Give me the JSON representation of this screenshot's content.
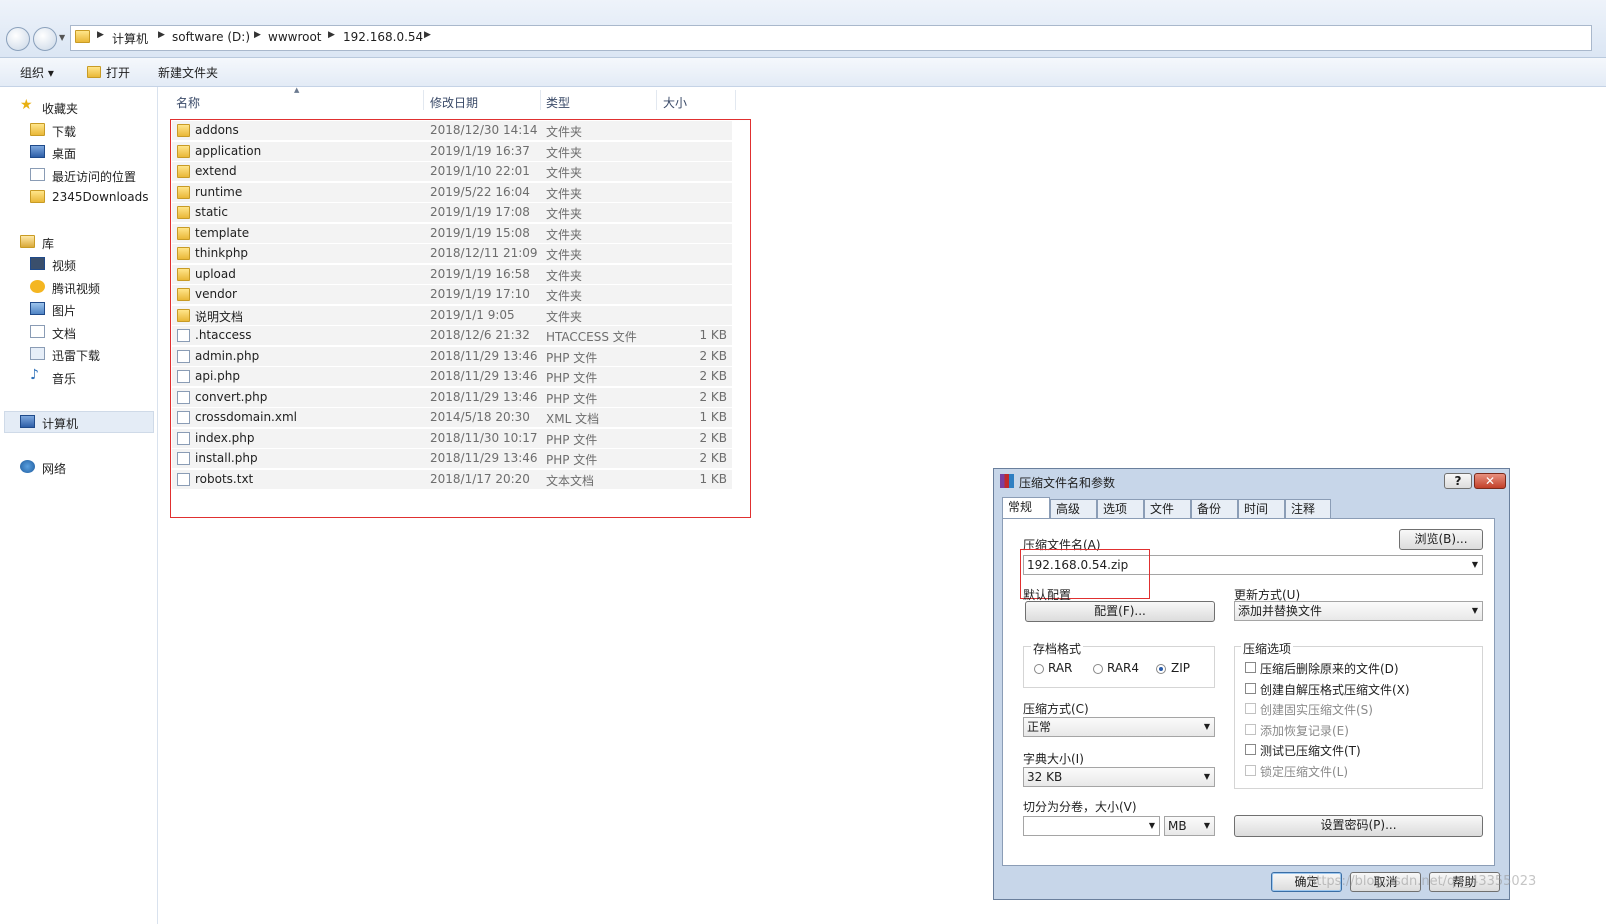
{
  "address_bar": {
    "crumbs": [
      "计算机",
      "software (D:)",
      "wwwroot",
      "192.168.0.54"
    ]
  },
  "toolbar": {
    "organize": "组织 ▾",
    "open": "打开",
    "new_folder": "新建文件夹"
  },
  "sidebar": {
    "favorites": "收藏夹",
    "favorite_items": [
      "下载",
      "桌面",
      "最近访问的位置",
      "2345Downloads"
    ],
    "libraries": "库",
    "library_items": [
      "视频",
      "腾讯视频",
      "图片",
      "文档",
      "迅雷下载",
      "音乐"
    ],
    "computer": "计算机",
    "network": "网络"
  },
  "columns": {
    "name": "名称",
    "date": "修改日期",
    "type": "类型",
    "size": "大小"
  },
  "files": [
    {
      "name": "addons",
      "date": "2018/12/30 14:14",
      "type": "文件夹",
      "size": "",
      "kind": "folder"
    },
    {
      "name": "application",
      "date": "2019/1/19 16:37",
      "type": "文件夹",
      "size": "",
      "kind": "folder"
    },
    {
      "name": "extend",
      "date": "2019/1/10 22:01",
      "type": "文件夹",
      "size": "",
      "kind": "folder"
    },
    {
      "name": "runtime",
      "date": "2019/5/22 16:04",
      "type": "文件夹",
      "size": "",
      "kind": "folder"
    },
    {
      "name": "static",
      "date": "2019/1/19 17:08",
      "type": "文件夹",
      "size": "",
      "kind": "folder"
    },
    {
      "name": "template",
      "date": "2019/1/19 15:08",
      "type": "文件夹",
      "size": "",
      "kind": "folder"
    },
    {
      "name": "thinkphp",
      "date": "2018/12/11 21:09",
      "type": "文件夹",
      "size": "",
      "kind": "folder"
    },
    {
      "name": "upload",
      "date": "2019/1/19 16:58",
      "type": "文件夹",
      "size": "",
      "kind": "folder"
    },
    {
      "name": "vendor",
      "date": "2019/1/19 17:10",
      "type": "文件夹",
      "size": "",
      "kind": "folder"
    },
    {
      "name": "说明文档",
      "date": "2019/1/1 9:05",
      "type": "文件夹",
      "size": "",
      "kind": "folder"
    },
    {
      "name": ".htaccess",
      "date": "2018/12/6 21:32",
      "type": "HTACCESS 文件",
      "size": "1 KB",
      "kind": "file"
    },
    {
      "name": "admin.php",
      "date": "2018/11/29 13:46",
      "type": "PHP 文件",
      "size": "2 KB",
      "kind": "file"
    },
    {
      "name": "api.php",
      "date": "2018/11/29 13:46",
      "type": "PHP 文件",
      "size": "2 KB",
      "kind": "file"
    },
    {
      "name": "convert.php",
      "date": "2018/11/29 13:46",
      "type": "PHP 文件",
      "size": "2 KB",
      "kind": "file"
    },
    {
      "name": "crossdomain.xml",
      "date": "2014/5/18 20:30",
      "type": "XML 文档",
      "size": "1 KB",
      "kind": "file"
    },
    {
      "name": "index.php",
      "date": "2018/11/30 10:17",
      "type": "PHP 文件",
      "size": "2 KB",
      "kind": "file"
    },
    {
      "name": "install.php",
      "date": "2018/11/29 13:46",
      "type": "PHP 文件",
      "size": "2 KB",
      "kind": "file"
    },
    {
      "name": "robots.txt",
      "date": "2018/1/17 20:20",
      "type": "文本文档",
      "size": "1 KB",
      "kind": "file"
    }
  ],
  "dialog": {
    "title": "压缩文件名和参数",
    "help": "?",
    "close": "✕",
    "tabs": [
      "常规",
      "高级",
      "选项",
      "文件",
      "备份",
      "时间",
      "注释"
    ],
    "archive_name_label": "压缩文件名(A)",
    "browse": "浏览(B)...",
    "archive_name": "192.168.0.54.zip",
    "default_profile_label": "默认配置",
    "profiles_button": "配置(F)...",
    "update_mode_label": "更新方式(U)",
    "update_mode": "添加并替换文件",
    "format_label": "存档格式",
    "formats": [
      "RAR",
      "RAR4",
      "ZIP"
    ],
    "selected_format": "ZIP",
    "method_label": "压缩方式(C)",
    "method": "正常",
    "dict_label": "字典大小(I)",
    "dict": "32 KB",
    "split_label": "切分为分卷，大小(V)",
    "split_value": "",
    "split_unit": "MB",
    "options_label": "压缩选项",
    "options": [
      {
        "label": "压缩后删除原来的文件(D)",
        "enabled": true
      },
      {
        "label": "创建自解压格式压缩文件(X)",
        "enabled": true
      },
      {
        "label": "创建固实压缩文件(S)",
        "enabled": false
      },
      {
        "label": "添加恢复记录(E)",
        "enabled": false
      },
      {
        "label": "测试已压缩文件(T)",
        "enabled": true
      },
      {
        "label": "锁定压缩文件(L)",
        "enabled": false
      }
    ],
    "set_password": "设置密码(P)...",
    "ok": "确定",
    "cancel": "取消",
    "help_button": "帮助"
  },
  "watermark": "https://blog.csdn.net/qq_43355023"
}
